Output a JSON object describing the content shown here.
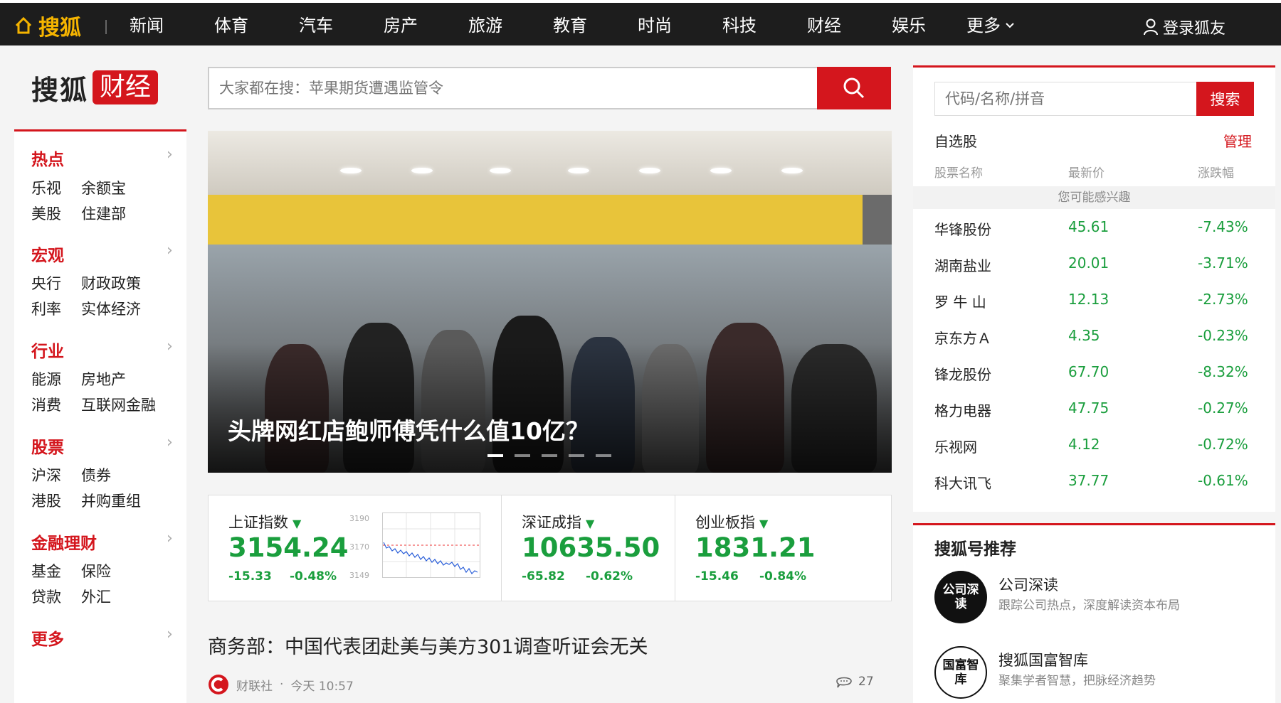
{
  "topnav": {
    "logo": "搜狐",
    "items": [
      "新闻",
      "体育",
      "汽车",
      "房产",
      "旅游",
      "教育",
      "时尚",
      "科技",
      "财经",
      "娱乐",
      "更多"
    ],
    "login": "登录狐友"
  },
  "brand": {
    "sohu": "搜狐",
    "caijing": "财经"
  },
  "search": {
    "placeholder": "大家都在搜：苹果期货遭遇监管令"
  },
  "left_nav": [
    {
      "category": "热点",
      "subs": [
        "乐视",
        "余额宝",
        "美股",
        "住建部"
      ]
    },
    {
      "category": "宏观",
      "subs": [
        "央行",
        "财政政策",
        "利率",
        "实体经济"
      ]
    },
    {
      "category": "行业",
      "subs": [
        "能源",
        "房地产",
        "消费",
        "互联网金融"
      ]
    },
    {
      "category": "股票",
      "subs": [
        "沪深",
        "债券",
        "港股",
        "并购重组"
      ]
    },
    {
      "category": "金融理财",
      "subs": [
        "基金",
        "保险",
        "贷款",
        "外汇"
      ]
    },
    {
      "category": "更多",
      "subs": []
    }
  ],
  "hero": {
    "caption": "头牌网红店鲍师傅凭什么值10亿？",
    "slides": 5,
    "active_slide": 1
  },
  "indices": [
    {
      "name": "上证指数",
      "value": "3154.24",
      "change": "-15.33",
      "pct": "-0.48%"
    },
    {
      "name": "深证成指",
      "value": "10635.50",
      "change": "-65.82",
      "pct": "-0.62%"
    },
    {
      "name": "创业板指",
      "value": "1831.21",
      "change": "-15.46",
      "pct": "-0.84%"
    }
  ],
  "minichart": {
    "ticks": [
      "3190",
      "3170",
      "3149"
    ]
  },
  "news": {
    "title": "商务部：中国代表团赴美与美方301调查听证会无关",
    "source": "财联社",
    "dot": "·",
    "time": "今天 10:57",
    "comments": "27"
  },
  "stock_panel": {
    "search_placeholder": "代码/名称/拼音",
    "search_button": "搜索",
    "watchlist": "自选股",
    "manage": "管理",
    "col_name": "股票名称",
    "col_price": "最新价",
    "col_change": "涨跌幅",
    "interest": "您可能感兴趣",
    "rows": [
      {
        "name": "华锋股份",
        "price": "45.61",
        "change": "-7.43%"
      },
      {
        "name": "湖南盐业",
        "price": "20.01",
        "change": "-3.71%"
      },
      {
        "name": "罗 牛 山",
        "price": "12.13",
        "change": "-2.73%"
      },
      {
        "name": "京东方Ａ",
        "price": "4.35",
        "change": "-0.23%"
      },
      {
        "name": "锋龙股份",
        "price": "67.70",
        "change": "-8.32%"
      },
      {
        "name": "格力电器",
        "price": "47.75",
        "change": "-0.27%"
      },
      {
        "name": "乐视网",
        "price": "4.12",
        "change": "-0.72%"
      },
      {
        "name": "科大讯飞",
        "price": "37.77",
        "change": "-0.61%"
      }
    ]
  },
  "sohuhao": {
    "title": "搜狐号推荐",
    "accounts": [
      {
        "name": "公司深读",
        "desc": "跟踪公司热点，深度解读资本布局",
        "avatar_text": "公司深读"
      },
      {
        "name": "搜狐国富智库",
        "desc": "聚集学者智慧，把脉经济趋势",
        "avatar_text": "国富智库"
      }
    ]
  },
  "colors": {
    "accent": "#d4161d",
    "down": "#1a9e3d",
    "nav_bg": "#1d1d1d"
  }
}
